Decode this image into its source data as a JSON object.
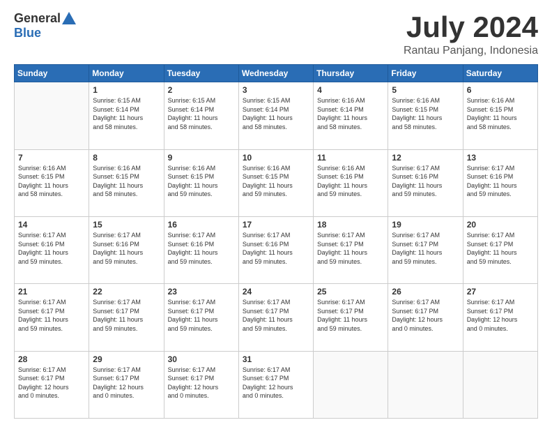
{
  "header": {
    "logo_general": "General",
    "logo_blue": "Blue",
    "month_title": "July 2024",
    "location": "Rantau Panjang, Indonesia"
  },
  "days_of_week": [
    "Sunday",
    "Monday",
    "Tuesday",
    "Wednesday",
    "Thursday",
    "Friday",
    "Saturday"
  ],
  "weeks": [
    [
      {
        "day": "",
        "info": ""
      },
      {
        "day": "1",
        "info": "Sunrise: 6:15 AM\nSunset: 6:14 PM\nDaylight: 11 hours\nand 58 minutes."
      },
      {
        "day": "2",
        "info": "Sunrise: 6:15 AM\nSunset: 6:14 PM\nDaylight: 11 hours\nand 58 minutes."
      },
      {
        "day": "3",
        "info": "Sunrise: 6:15 AM\nSunset: 6:14 PM\nDaylight: 11 hours\nand 58 minutes."
      },
      {
        "day": "4",
        "info": "Sunrise: 6:16 AM\nSunset: 6:14 PM\nDaylight: 11 hours\nand 58 minutes."
      },
      {
        "day": "5",
        "info": "Sunrise: 6:16 AM\nSunset: 6:15 PM\nDaylight: 11 hours\nand 58 minutes."
      },
      {
        "day": "6",
        "info": "Sunrise: 6:16 AM\nSunset: 6:15 PM\nDaylight: 11 hours\nand 58 minutes."
      }
    ],
    [
      {
        "day": "7",
        "info": ""
      },
      {
        "day": "8",
        "info": "Sunrise: 6:16 AM\nSunset: 6:15 PM\nDaylight: 11 hours\nand 58 minutes."
      },
      {
        "day": "9",
        "info": "Sunrise: 6:16 AM\nSunset: 6:15 PM\nDaylight: 11 hours\nand 59 minutes."
      },
      {
        "day": "10",
        "info": "Sunrise: 6:16 AM\nSunset: 6:15 PM\nDaylight: 11 hours\nand 59 minutes."
      },
      {
        "day": "11",
        "info": "Sunrise: 6:16 AM\nSunset: 6:16 PM\nDaylight: 11 hours\nand 59 minutes."
      },
      {
        "day": "12",
        "info": "Sunrise: 6:17 AM\nSunset: 6:16 PM\nDaylight: 11 hours\nand 59 minutes."
      },
      {
        "day": "13",
        "info": "Sunrise: 6:17 AM\nSunset: 6:16 PM\nDaylight: 11 hours\nand 59 minutes."
      }
    ],
    [
      {
        "day": "14",
        "info": ""
      },
      {
        "day": "15",
        "info": "Sunrise: 6:17 AM\nSunset: 6:16 PM\nDaylight: 11 hours\nand 59 minutes."
      },
      {
        "day": "16",
        "info": "Sunrise: 6:17 AM\nSunset: 6:16 PM\nDaylight: 11 hours\nand 59 minutes."
      },
      {
        "day": "17",
        "info": "Sunrise: 6:17 AM\nSunset: 6:16 PM\nDaylight: 11 hours\nand 59 minutes."
      },
      {
        "day": "18",
        "info": "Sunrise: 6:17 AM\nSunset: 6:17 PM\nDaylight: 11 hours\nand 59 minutes."
      },
      {
        "day": "19",
        "info": "Sunrise: 6:17 AM\nSunset: 6:17 PM\nDaylight: 11 hours\nand 59 minutes."
      },
      {
        "day": "20",
        "info": "Sunrise: 6:17 AM\nSunset: 6:17 PM\nDaylight: 11 hours\nand 59 minutes."
      }
    ],
    [
      {
        "day": "21",
        "info": ""
      },
      {
        "day": "22",
        "info": "Sunrise: 6:17 AM\nSunset: 6:17 PM\nDaylight: 11 hours\nand 59 minutes."
      },
      {
        "day": "23",
        "info": "Sunrise: 6:17 AM\nSunset: 6:17 PM\nDaylight: 11 hours\nand 59 minutes."
      },
      {
        "day": "24",
        "info": "Sunrise: 6:17 AM\nSunset: 6:17 PM\nDaylight: 11 hours\nand 59 minutes."
      },
      {
        "day": "25",
        "info": "Sunrise: 6:17 AM\nSunset: 6:17 PM\nDaylight: 11 hours\nand 59 minutes."
      },
      {
        "day": "26",
        "info": "Sunrise: 6:17 AM\nSunset: 6:17 PM\nDaylight: 12 hours\nand 0 minutes."
      },
      {
        "day": "27",
        "info": "Sunrise: 6:17 AM\nSunset: 6:17 PM\nDaylight: 12 hours\nand 0 minutes."
      }
    ],
    [
      {
        "day": "28",
        "info": "Sunrise: 6:17 AM\nSunset: 6:17 PM\nDaylight: 12 hours\nand 0 minutes."
      },
      {
        "day": "29",
        "info": "Sunrise: 6:17 AM\nSunset: 6:17 PM\nDaylight: 12 hours\nand 0 minutes."
      },
      {
        "day": "30",
        "info": "Sunrise: 6:17 AM\nSunset: 6:17 PM\nDaylight: 12 hours\nand 0 minutes."
      },
      {
        "day": "31",
        "info": "Sunrise: 6:17 AM\nSunset: 6:17 PM\nDaylight: 12 hours\nand 0 minutes."
      },
      {
        "day": "",
        "info": ""
      },
      {
        "day": "",
        "info": ""
      },
      {
        "day": "",
        "info": ""
      }
    ]
  ],
  "row7_sunday_info": "Sunrise: 6:16 AM\nSunset: 6:15 PM\nDaylight: 11 hours\nand 58 minutes.",
  "row14_sunday_info": "Sunrise: 6:17 AM\nSunset: 6:16 PM\nDaylight: 11 hours\nand 59 minutes.",
  "row21_sunday_info": "Sunrise: 6:17 AM\nSunset: 6:17 PM\nDaylight: 11 hours\nand 59 minutes."
}
